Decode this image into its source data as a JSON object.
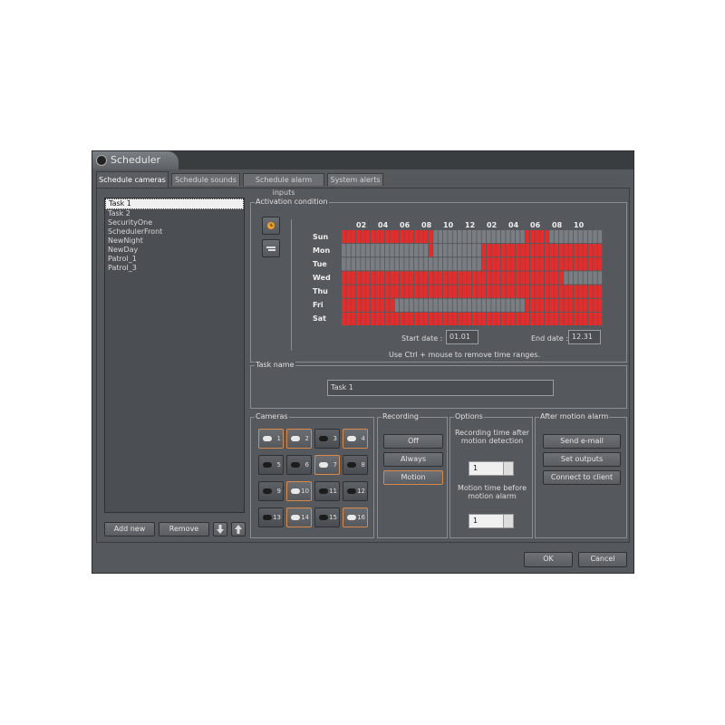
{
  "window": {
    "title": "Scheduler"
  },
  "tabs": [
    {
      "label": "Schedule cameras",
      "active": true
    },
    {
      "label": "Schedule sounds"
    },
    {
      "label": "Schedule alarm inputs"
    },
    {
      "label": "System alerts"
    }
  ],
  "tasks": [
    "Task 1",
    "Task 2",
    "SecurityOne",
    "SchedulerFront",
    "NewNight",
    "NewDay",
    "Patrol_1",
    "Patrol_3"
  ],
  "selected_task": 0,
  "task_buttons": {
    "add": "Add new",
    "remove": "Remove"
  },
  "activation": {
    "label": "Activation condition",
    "hours": [
      "02",
      "04",
      "06",
      "08",
      "10",
      "12",
      "02",
      "04",
      "06",
      "08",
      "10"
    ],
    "days": [
      "Sun",
      "Mon",
      "Tue",
      "Wed",
      "Thu",
      "Fri",
      "Sat"
    ],
    "grid": [
      "111111111111111111100000000000000000001111100000000000",
      "000000000000000000100000000001111111111111111111111111",
      "000000000000000000000000000001111111111111111111111111",
      "111111111111111111111111111111111111111111111100000000",
      "111111111111111111111111111111111111111111111111111111",
      "111111111110000000000000000000000000001111111111111111",
      "111111111111111111111111111111111111111111111111111111"
    ],
    "start_date_label": "Start date :",
    "start_date": "01.01",
    "end_date_label": "End date :",
    "end_date": "12.31",
    "hint": "Use Ctrl + mouse to remove time ranges.",
    "colors": {
      "on": "#e62b2b",
      "off": "#7a7e82"
    }
  },
  "task_name": {
    "label": "Task name",
    "value": "Task 1"
  },
  "cameras": {
    "label": "Cameras",
    "items": [
      {
        "n": "1",
        "on": true
      },
      {
        "n": "2",
        "on": true
      },
      {
        "n": "3",
        "on": false
      },
      {
        "n": "4",
        "on": true
      },
      {
        "n": "5",
        "on": false
      },
      {
        "n": "6",
        "on": false
      },
      {
        "n": "7",
        "on": true
      },
      {
        "n": "8",
        "on": false
      },
      {
        "n": "9",
        "on": false
      },
      {
        "n": "10",
        "on": true
      },
      {
        "n": "11",
        "on": false
      },
      {
        "n": "12",
        "on": false
      },
      {
        "n": "13",
        "on": false
      },
      {
        "n": "14",
        "on": true
      },
      {
        "n": "15",
        "on": false
      },
      {
        "n": "16",
        "on": true
      }
    ]
  },
  "recording": {
    "label": "Recording",
    "off": "Off",
    "always": "Always",
    "motion": "Motion"
  },
  "options": {
    "label": "Options",
    "after_label": "Recording time after motion detection",
    "after_value": "1",
    "before_label": "Motion time before motion alarm",
    "before_value": "1"
  },
  "after_alarm": {
    "label": "After motion alarm",
    "email": "Send e-mail",
    "outputs": "Set outputs",
    "connect": "Connect to client"
  },
  "footer": {
    "ok": "OK",
    "cancel": "Cancel"
  }
}
